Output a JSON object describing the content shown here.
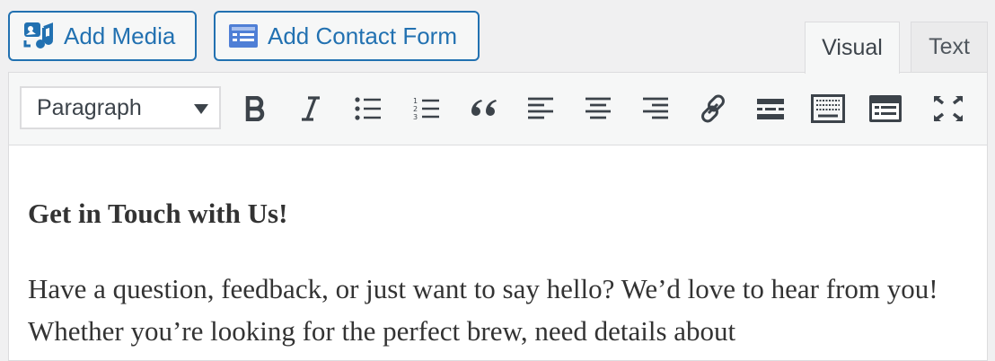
{
  "media_buttons": {
    "add_media": "Add Media",
    "add_contact_form": "Add Contact Form"
  },
  "tabs": {
    "visual": "Visual",
    "text": "Text",
    "active": "Visual"
  },
  "toolbar": {
    "format_select": {
      "selected": "Paragraph"
    },
    "buttons": [
      "bold-icon",
      "italic-icon",
      "bullet-list-icon",
      "numbered-list-icon",
      "blockquote-icon",
      "align-left-icon",
      "align-center-icon",
      "align-right-icon",
      "link-icon",
      "read-more-icon",
      "toolbar-toggle-icon",
      "form-icon",
      "fullscreen-icon"
    ]
  },
  "content": {
    "heading": "Get in Touch with Us!",
    "paragraph": "Have a question, feedback, or just want to say hello? We’d love to hear from you! Whether you’re looking for the perfect brew, need details about"
  },
  "colors": {
    "accent": "#2271b1",
    "icon": "#3c434a",
    "background": "#f0f0f1"
  }
}
